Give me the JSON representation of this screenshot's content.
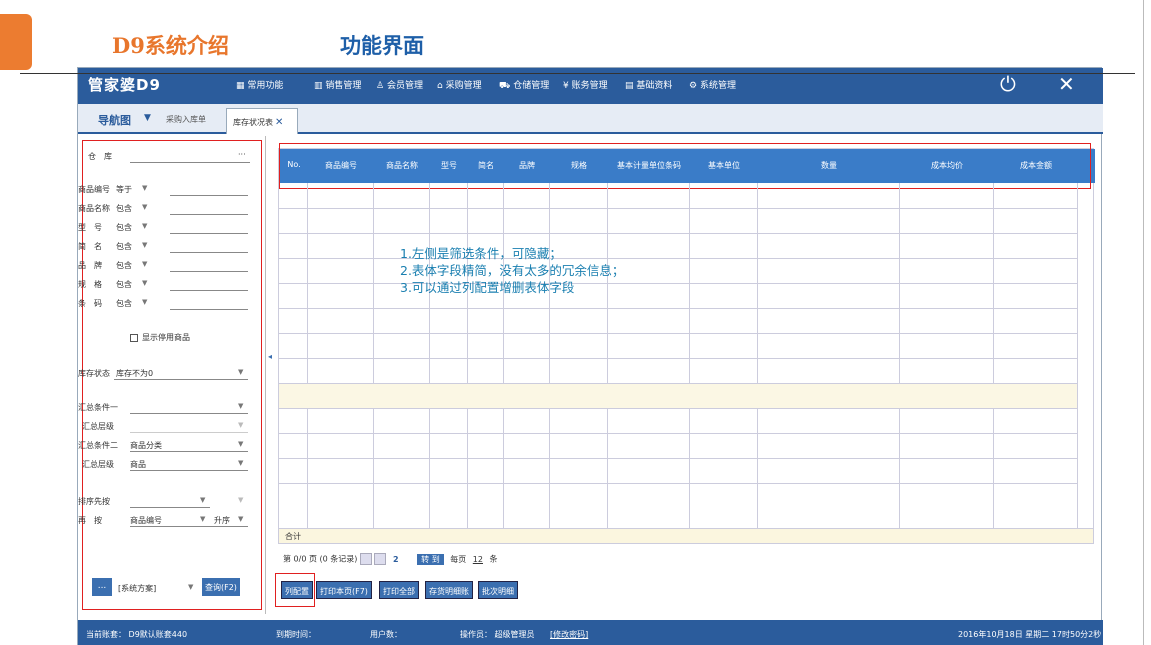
{
  "slide": {
    "title_left": "D9系统介绍",
    "title_right": "功能界面"
  },
  "app": {
    "logo": "管家婆D9",
    "menu": [
      "常用功能",
      "销售管理",
      "会员管理",
      "采购管理",
      "仓储管理",
      "账务管理",
      "基础资料",
      "系统管理"
    ],
    "menu_icons": [
      "grid-icon",
      "chart-icon",
      "user-icon",
      "home-icon",
      "cart-icon",
      "yen-icon",
      "doc-icon",
      "gear-icon"
    ],
    "power_icon": "⏻",
    "close_icon": "✕"
  },
  "tabs": {
    "nav_label": "导航图",
    "tab1": "采购入库单",
    "tab2": "库存状况表"
  },
  "filters": {
    "warehouse_label": "仓　库",
    "warehouse_more": "···",
    "rows": [
      {
        "label": "商品编号",
        "op": "等于"
      },
      {
        "label": "商品名称",
        "op": "包含"
      },
      {
        "label": "型　号",
        "op": "包含"
      },
      {
        "label": "简　名",
        "op": "包含"
      },
      {
        "label": "品　牌",
        "op": "包含"
      },
      {
        "label": "规　格",
        "op": "包含"
      },
      {
        "label": "条　码",
        "op": "包含"
      }
    ],
    "show_disabled": "显示停用商品",
    "stock_status_label": "库存状态",
    "stock_status_value": "库存不为0",
    "group1_label": "汇总条件一",
    "group1_level_label": "汇总层级",
    "group2_label": "汇总条件二",
    "group2_value": "商品分类",
    "group2_level_label": "汇总层级",
    "group2_level_value": "商品",
    "sort_label": "排序先按",
    "then_label": "再　按",
    "then_value": "商品编号",
    "then_order": "升序",
    "scheme_button": "...",
    "scheme_value": "[系统方案]",
    "query_button": "查询(F2)"
  },
  "grid": {
    "columns": [
      "No.",
      "商品编号",
      "商品名称",
      "型号",
      "简名",
      "品牌",
      "规格",
      "基本计量单位条码",
      "基本单位",
      "数量",
      "成本均价",
      "成本金额"
    ],
    "sum_label": "合计"
  },
  "pager": {
    "page_text": "第 0/0 页 (0 条记录)",
    "page_num": "2",
    "goto_button": "转 到",
    "per_page_label": "每页",
    "per_page_value": "12",
    "per_page_unit": "条"
  },
  "buttons": [
    "列配置",
    "打印本页(F7)",
    "打印全部",
    "存货明细账",
    "批次明细"
  ],
  "status": {
    "account": "当前账套： D9默认账套440",
    "expire": "到期时间：",
    "users": "用户数：",
    "operator": "操作员： 超级管理员",
    "change_password": "[修改密码]",
    "datetime": "2016年10月18日 星期二 17时50分2秒"
  },
  "note": {
    "line1": "1.左侧是筛选条件，可隐藏；",
    "line2": "2.表体字段精简，没有太多的冗余信息；",
    "line3": "3.可以通过列配置增删表体字段"
  }
}
